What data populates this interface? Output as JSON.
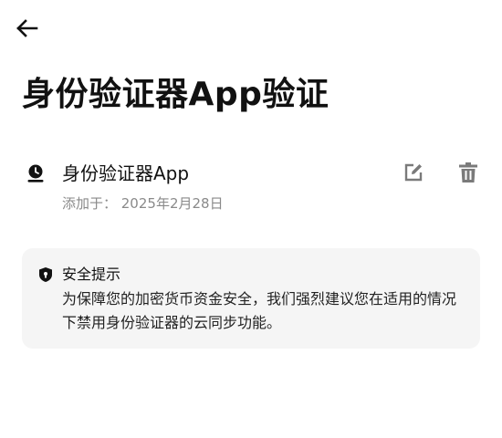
{
  "header": {
    "back_icon": "arrow-left-icon",
    "title": "身份验证器App验证"
  },
  "authenticator": {
    "icon": "authenticator-icon",
    "name": "身份验证器App",
    "added_date": "添加于：  2025年2月28日",
    "edit_icon": "edit-icon",
    "delete_icon": "trash-icon"
  },
  "notice": {
    "icon": "shield-icon",
    "title": "安全提示",
    "body": "为保障您的加密货币资金安全，我们强烈建议您在适用的情况下禁用身份验证器的云同步功能。",
    "background": "#f5f5f5"
  },
  "colors": {
    "text_primary": "#111111",
    "text_secondary": "#8a8a8a",
    "icon_gray": "#7a7a7a"
  }
}
